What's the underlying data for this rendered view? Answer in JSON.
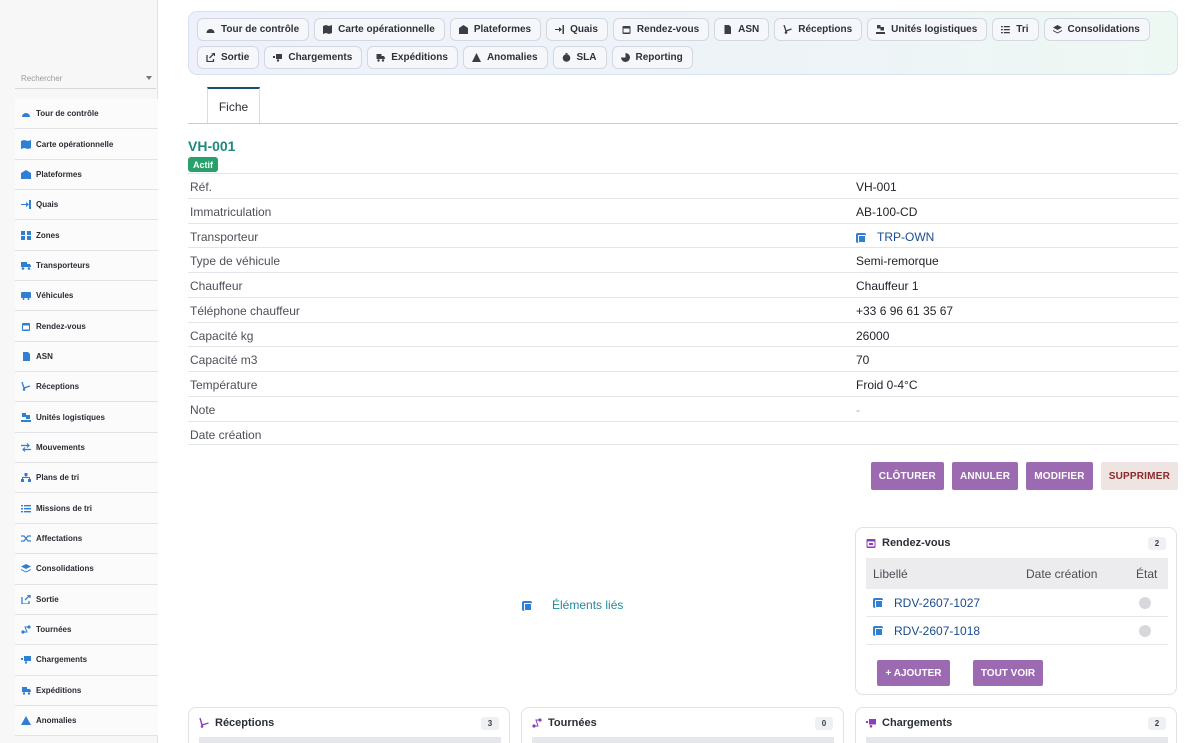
{
  "sidebar": {
    "search_placeholder": "Rechercher",
    "items": [
      {
        "label": "Tour de contrôle",
        "icon": "gauge-icon"
      },
      {
        "label": "Carte opérationnelle",
        "icon": "map-icon"
      },
      {
        "label": "Plateformes",
        "icon": "warehouse-icon"
      },
      {
        "label": "Quais",
        "icon": "dock-entry-icon"
      },
      {
        "label": "Zones",
        "icon": "grid-icon"
      },
      {
        "label": "Transporteurs",
        "icon": "truck-icon"
      },
      {
        "label": "Véhicules",
        "icon": "bus-icon"
      },
      {
        "label": "Rendez-vous",
        "icon": "calendar-icon"
      },
      {
        "label": "ASN",
        "icon": "document-arrow-icon"
      },
      {
        "label": "Réceptions",
        "icon": "dolly-icon"
      },
      {
        "label": "Unités logistiques",
        "icon": "pallet-boxes-icon"
      },
      {
        "label": "Mouvements",
        "icon": "swap-arrows-icon"
      },
      {
        "label": "Plans de tri",
        "icon": "sitemap-icon"
      },
      {
        "label": "Missions de tri",
        "icon": "list-icon"
      },
      {
        "label": "Affectations",
        "icon": "shuffle-icon"
      },
      {
        "label": "Consolidations",
        "icon": "layers-icon"
      },
      {
        "label": "Sortie",
        "icon": "external-link-icon"
      },
      {
        "label": "Tournées",
        "icon": "route-icon"
      },
      {
        "label": "Chargements",
        "icon": "truck-loading-icon"
      },
      {
        "label": "Expéditions",
        "icon": "shipping-fast-icon"
      },
      {
        "label": "Anomalies",
        "icon": "warning-icon"
      }
    ]
  },
  "toolbar": {
    "row1": [
      {
        "label": "Tour de contrôle",
        "icon": "gauge-icon"
      },
      {
        "label": "Carte opérationnelle",
        "icon": "map-icon"
      },
      {
        "label": "Plateformes",
        "icon": "warehouse-icon"
      },
      {
        "label": "Quais",
        "icon": "dock-entry-icon"
      },
      {
        "label": "Rendez-vous",
        "icon": "calendar-icon"
      },
      {
        "label": "ASN",
        "icon": "document-arrow-icon"
      },
      {
        "label": "Réceptions",
        "icon": "dolly-icon"
      },
      {
        "label": "Unités logistiques",
        "icon": "pallet-boxes-icon"
      },
      {
        "label": "Tri",
        "icon": "list-icon"
      },
      {
        "label": "Consolidations",
        "icon": "layers-icon"
      }
    ],
    "row2": [
      {
        "label": "Sortie",
        "icon": "external-link-icon"
      },
      {
        "label": "Chargements",
        "icon": "truck-loading-icon"
      },
      {
        "label": "Expéditions",
        "icon": "shipping-fast-icon"
      },
      {
        "label": "Anomalies",
        "icon": "warning-icon"
      },
      {
        "label": "SLA",
        "icon": "stopwatch-icon"
      },
      {
        "label": "Reporting",
        "icon": "pie-chart-icon"
      }
    ]
  },
  "tab": {
    "label": "Fiche"
  },
  "record": {
    "title": "VH-001",
    "status": "Actif",
    "fields": [
      {
        "label": "Réf.",
        "value": "VH-001"
      },
      {
        "label": "Immatriculation",
        "value": "AB-100-CD"
      },
      {
        "label": "Transporteur",
        "value": "TRP-OWN",
        "link": true
      },
      {
        "label": "Type de véhicule",
        "value": "Semi-remorque"
      },
      {
        "label": "Chauffeur",
        "value": "Chauffeur 1"
      },
      {
        "label": "Téléphone chauffeur",
        "value": "+33 6 96 61 35 67"
      },
      {
        "label": "Capacité kg",
        "value": "26000"
      },
      {
        "label": "Capacité m3",
        "value": "70"
      },
      {
        "label": "Température",
        "value": "Froid 0-4°C"
      },
      {
        "label": "Note",
        "value": "-",
        "muted": true
      },
      {
        "label": "Date création",
        "value": ""
      }
    ]
  },
  "actions": {
    "close": "CLÔTURER",
    "cancel": "ANNULER",
    "edit": "MODIFIER",
    "delete": "SUPPRIMER"
  },
  "linked": {
    "label": "Éléments liés"
  },
  "rdv_card": {
    "title": "Rendez-vous",
    "count": "2",
    "columns": [
      "Libellé",
      "Date création",
      "État"
    ],
    "rows": [
      {
        "label": "RDV-2607-1027"
      },
      {
        "label": "RDV-2607-1018"
      }
    ],
    "add_label": "+ AJOUTER",
    "all_label": "TOUT VOIR"
  },
  "bottom_cards": [
    {
      "title": "Réceptions",
      "count": "3",
      "icon": "dolly-icon"
    },
    {
      "title": "Tournées",
      "count": "0",
      "icon": "route-icon"
    },
    {
      "title": "Chargements",
      "count": "2",
      "icon": "truck-loading-icon"
    }
  ],
  "colors": {
    "teal": "#1f8a7c",
    "link": "#1a4d8f",
    "purple_button": "#9b6ab0",
    "active_badge": "#27a06b",
    "icon_blue": "#2f7fd2"
  }
}
